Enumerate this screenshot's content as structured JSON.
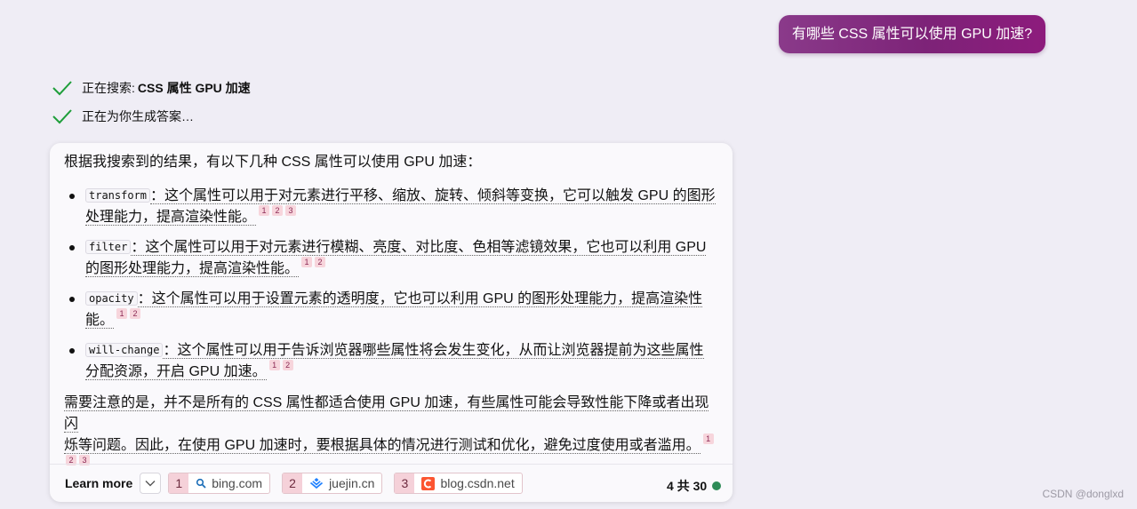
{
  "user_message": "有哪些 CSS 属性可以使用 GPU 加速?",
  "status": [
    {
      "text": "正在搜索: ",
      "bold": "CSS 属性 GPU 加速",
      "icon": "checkmark-icon"
    },
    {
      "text": "正在为你生成答案…",
      "bold": "",
      "icon": "checkmark-icon"
    }
  ],
  "answer": {
    "intro": "根据我搜索到的结果，有以下几种 CSS 属性可以使用 GPU 加速：",
    "bullets": [
      {
        "code": "transform",
        "line1": "：这个属性可以用于对元素进行平移、缩放、旋转、倾斜等变换，它可以触发 GPU 的图形",
        "line2": "处理能力，提高渲染性能。",
        "cites": [
          "1",
          "2",
          "3"
        ]
      },
      {
        "code": "filter",
        "line1": "：这个属性可以用于对元素进行模糊、亮度、对比度、色相等滤镜效果，它也可以利用 GPU",
        "line2": "的图形处理能力，提高渲染性能。",
        "cites": [
          "1",
          "2"
        ]
      },
      {
        "code": "opacity",
        "line1": "：这个属性可以用于设置元素的透明度，它也可以利用 GPU 的图形处理能力，提高渲染性",
        "line2": "能。",
        "cites": [
          "1",
          "2"
        ]
      },
      {
        "code": "will-change",
        "line1": "：这个属性可以用于告诉浏览器哪些属性将会发生变化，从而让浏览器提前为这些属性",
        "line2": "分配资源，开启 GPU 加速。",
        "cites": [
          "1",
          "2"
        ]
      }
    ],
    "note_line1": "需要注意的是，并不是所有的 CSS 属性都适合使用 GPU 加速，有些属性可能会导致性能下降或者出现闪",
    "note_line2": "烁等问题。因此，在使用 GPU 加速时，要根据具体的情况进行测试和优化，避免过度使用或者滥用。",
    "note_cites": [
      "1",
      "2",
      "3"
    ]
  },
  "footer": {
    "learn_more": "Learn more",
    "sources": [
      {
        "num": "1",
        "host": "bing.com",
        "icon": "search-icon"
      },
      {
        "num": "2",
        "host": "juejin.cn",
        "icon": "juejin-logo-icon"
      },
      {
        "num": "3",
        "host": "blog.csdn.net",
        "icon": "csdn-logo-icon"
      }
    ],
    "count": "4 共 30",
    "status_color": "#2e8b57"
  },
  "watermark": "CSDN @donglxd"
}
